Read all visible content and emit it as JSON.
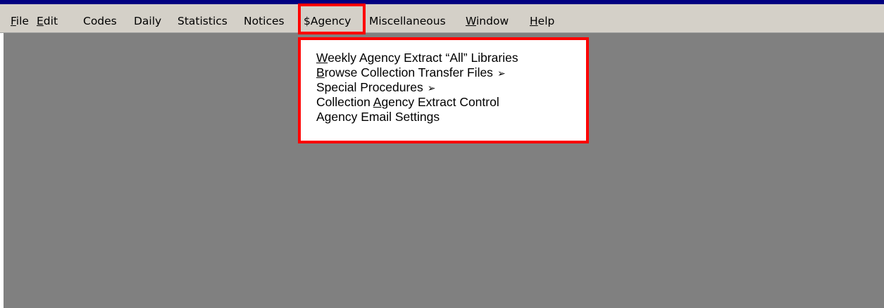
{
  "menubar": {
    "items": [
      {
        "mnemonic": "F",
        "rest": "ile"
      },
      {
        "mnemonic": "E",
        "rest": "dit"
      },
      {
        "mnemonic": "",
        "rest": "Codes"
      },
      {
        "mnemonic": "",
        "rest": "Daily"
      },
      {
        "mnemonic": "",
        "rest": "Statistics"
      },
      {
        "mnemonic": "",
        "rest": "Notices"
      },
      {
        "mnemonic": "",
        "rest": "$Agency"
      },
      {
        "mnemonic": "",
        "rest": "Miscellaneous"
      },
      {
        "mnemonic": "W",
        "rest": "indow"
      },
      {
        "mnemonic": "H",
        "rest": "elp"
      }
    ]
  },
  "agency_menu": {
    "items": [
      {
        "pre": "",
        "mnemonic": "W",
        "post": "eekly Agency Extract “All” Libraries",
        "submenu": ""
      },
      {
        "pre": "",
        "mnemonic": "B",
        "post": "rowse Collection Transfer Files",
        "submenu": "➢"
      },
      {
        "pre": "Special Procedures",
        "mnemonic": "",
        "post": "",
        "submenu": "➢"
      },
      {
        "pre": "Collection ",
        "mnemonic": "A",
        "post": "gency Extract Control",
        "submenu": ""
      },
      {
        "pre": "Agency Email Settings",
        "mnemonic": "",
        "post": "",
        "submenu": ""
      }
    ]
  },
  "colors": {
    "titlebar": "#000080",
    "menubar": "#d4d0c8",
    "workspace": "#808080",
    "highlight": "#ff0000"
  }
}
